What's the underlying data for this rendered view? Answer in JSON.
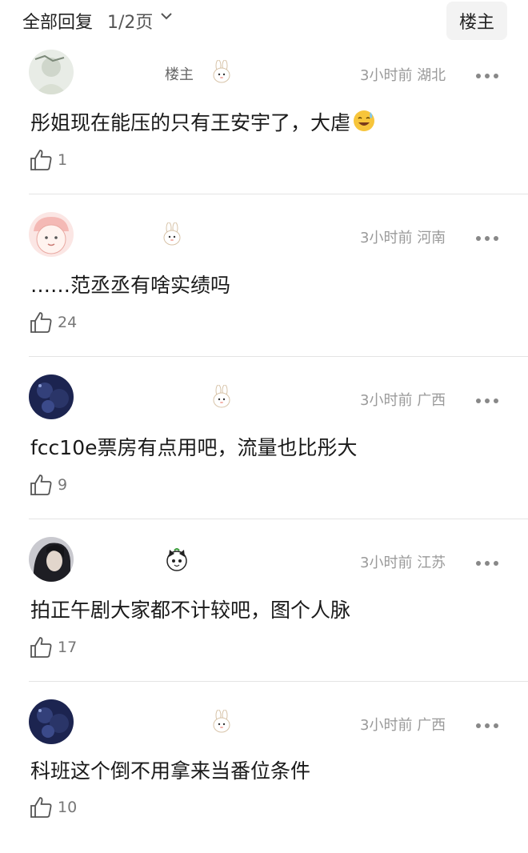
{
  "header": {
    "all_replies": "全部回复",
    "page_indicator": "1/2页",
    "op_button": "楼主"
  },
  "comments": [
    {
      "username": "",
      "op_badge": "楼主",
      "time": "3小时前",
      "location": "湖北",
      "text": "彤姐现在能压的只有王安宇了，大虐",
      "likes": "1"
    },
    {
      "username": "",
      "time": "3小时前",
      "location": "河南",
      "text": "……范丞丞有啥实绩吗",
      "likes": "24"
    },
    {
      "username": "",
      "time": "3小时前",
      "location": "广西",
      "text": "fcc10e票房有点用吧，流量也比彤大",
      "likes": "9"
    },
    {
      "username": "",
      "time": "3小时前",
      "location": "江苏",
      "text": "拍正午剧大家都不计较吧，图个人脉",
      "likes": "17"
    },
    {
      "username": "",
      "time": "3小时前",
      "location": "广西",
      "text": "科班这个倒不用拿来当番位条件",
      "likes": "10"
    }
  ],
  "colors": {
    "text": "#1a1a1a",
    "meta": "#9a9a9a",
    "divider": "#e4e4e4"
  }
}
